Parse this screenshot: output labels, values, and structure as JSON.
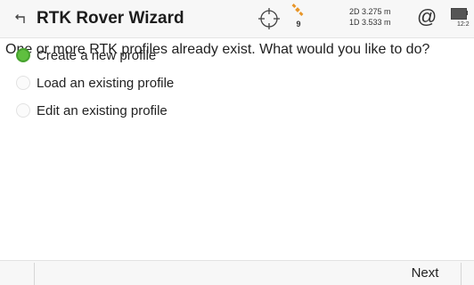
{
  "header": {
    "title": "RTK Rover Wizard",
    "satellite_count": "9",
    "precision_2d": "2D 3.275 m",
    "precision_1d": "1D 3.533 m",
    "at_symbol": "@",
    "clock": "12:2",
    "icons": [
      "back-arrow-icon",
      "gnss-target-icon",
      "satellite-icon",
      "at-icon",
      "battery-icon"
    ]
  },
  "main": {
    "question": "One or more RTK profiles already exist.  What would you like to do?",
    "options": [
      {
        "label": "Create a new profile",
        "selected": true
      },
      {
        "label": "Load an existing profile",
        "selected": false
      },
      {
        "label": "Edit an existing profile",
        "selected": false
      }
    ]
  },
  "footer": {
    "next_label": "Next"
  },
  "colors": {
    "selected_radio": "#5fbf3f",
    "header_bg": "#f7f7f7",
    "satellite_orange": "#e8962a"
  }
}
